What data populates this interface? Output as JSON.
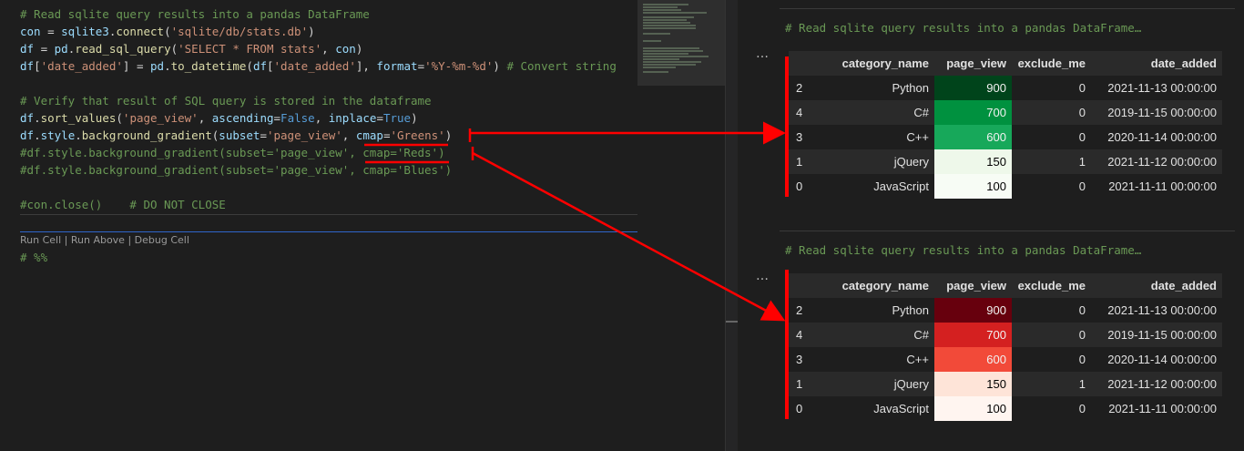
{
  "editor": {
    "lines": [
      [
        {
          "t": "# Read sqlite query results into a pandas DataFrame",
          "c": "cmt"
        }
      ],
      [
        {
          "t": "con",
          "c": "var"
        },
        {
          "t": " = ",
          "c": "pl"
        },
        {
          "t": "sqlite3",
          "c": "var"
        },
        {
          "t": ".",
          "c": "pl"
        },
        {
          "t": "connect",
          "c": "fn"
        },
        {
          "t": "(",
          "c": "pl"
        },
        {
          "t": "'sqlite/db/stats.db'",
          "c": "str"
        },
        {
          "t": ")",
          "c": "pl"
        }
      ],
      [
        {
          "t": "df",
          "c": "var"
        },
        {
          "t": " = ",
          "c": "pl"
        },
        {
          "t": "pd",
          "c": "var"
        },
        {
          "t": ".",
          "c": "pl"
        },
        {
          "t": "read_sql_query",
          "c": "fn"
        },
        {
          "t": "(",
          "c": "pl"
        },
        {
          "t": "'SELECT * FROM stats'",
          "c": "str"
        },
        {
          "t": ", ",
          "c": "pl"
        },
        {
          "t": "con",
          "c": "var"
        },
        {
          "t": ")",
          "c": "pl"
        }
      ],
      [
        {
          "t": "df",
          "c": "var"
        },
        {
          "t": "[",
          "c": "pl"
        },
        {
          "t": "'date_added'",
          "c": "str"
        },
        {
          "t": "] = ",
          "c": "pl"
        },
        {
          "t": "pd",
          "c": "var"
        },
        {
          "t": ".",
          "c": "pl"
        },
        {
          "t": "to_datetime",
          "c": "fn"
        },
        {
          "t": "(",
          "c": "pl"
        },
        {
          "t": "df",
          "c": "var"
        },
        {
          "t": "[",
          "c": "pl"
        },
        {
          "t": "'date_added'",
          "c": "str"
        },
        {
          "t": "], ",
          "c": "pl"
        },
        {
          "t": "format",
          "c": "var"
        },
        {
          "t": "=",
          "c": "pl"
        },
        {
          "t": "'%Y-%m-%d'",
          "c": "str"
        },
        {
          "t": ") ",
          "c": "pl"
        },
        {
          "t": "# Convert string",
          "c": "cmt"
        }
      ],
      [],
      [
        {
          "t": "# Verify that result of SQL query is stored in the dataframe",
          "c": "cmt"
        }
      ],
      [
        {
          "t": "df",
          "c": "var"
        },
        {
          "t": ".",
          "c": "pl"
        },
        {
          "t": "sort_values",
          "c": "fn"
        },
        {
          "t": "(",
          "c": "pl"
        },
        {
          "t": "'page_view'",
          "c": "str"
        },
        {
          "t": ", ",
          "c": "pl"
        },
        {
          "t": "ascending",
          "c": "var"
        },
        {
          "t": "=",
          "c": "pl"
        },
        {
          "t": "False",
          "c": "kw"
        },
        {
          "t": ", ",
          "c": "pl"
        },
        {
          "t": "inplace",
          "c": "var"
        },
        {
          "t": "=",
          "c": "pl"
        },
        {
          "t": "True",
          "c": "kw"
        },
        {
          "t": ")",
          "c": "pl"
        }
      ],
      [
        {
          "t": "df",
          "c": "var"
        },
        {
          "t": ".",
          "c": "pl"
        },
        {
          "t": "style",
          "c": "var"
        },
        {
          "t": ".",
          "c": "pl"
        },
        {
          "t": "background_gradient",
          "c": "fn"
        },
        {
          "t": "(",
          "c": "pl"
        },
        {
          "t": "subset",
          "c": "var"
        },
        {
          "t": "=",
          "c": "pl"
        },
        {
          "t": "'page_view'",
          "c": "str"
        },
        {
          "t": ", ",
          "c": "pl"
        },
        {
          "t": "cmap",
          "c": "var"
        },
        {
          "t": "=",
          "c": "pl"
        },
        {
          "t": "'Greens'",
          "c": "str"
        },
        {
          "t": ")",
          "c": "pl"
        }
      ],
      [
        {
          "t": "#df.style.background_gradient(subset='page_view', cmap='Reds')",
          "c": "cmt"
        }
      ],
      [
        {
          "t": "#df.style.background_gradient(subset='page_view', cmap='Blues')",
          "c": "cmt"
        }
      ],
      [],
      [
        {
          "t": "#con.close()    # DO NOT CLOSE",
          "c": "cmt"
        }
      ]
    ],
    "codelens": "Run Cell | Run Above | Debug Cell",
    "next_cell": "# %%"
  },
  "outputs": [
    {
      "header": "# Read sqlite query results into a pandas DataFrame…",
      "ellipsis": "…",
      "columns": [
        "",
        "category_name",
        "page_view",
        "exclude_me",
        "date_added"
      ],
      "rows": [
        {
          "idx": "2",
          "category": "Python",
          "page_view": "900",
          "exclude": "0",
          "date": "2021-11-13 00:00:00",
          "bg": "#00441b",
          "fg": "#f1f1f1"
        },
        {
          "idx": "4",
          "category": "C#",
          "page_view": "700",
          "exclude": "0",
          "date": "2019-11-15 00:00:00",
          "bg": "#00913f",
          "fg": "#f1f1f1"
        },
        {
          "idx": "3",
          "category": "C++",
          "page_view": "600",
          "exclude": "0",
          "date": "2020-11-14 00:00:00",
          "bg": "#17a85a",
          "fg": "#f1f1f1"
        },
        {
          "idx": "1",
          "category": "jQuery",
          "page_view": "150",
          "exclude": "1",
          "date": "2021-11-12 00:00:00",
          "bg": "#eef8ea",
          "fg": "#000000"
        },
        {
          "idx": "0",
          "category": "JavaScript",
          "page_view": "100",
          "exclude": "0",
          "date": "2021-11-11 00:00:00",
          "bg": "#f7fcf5",
          "fg": "#000000"
        }
      ]
    },
    {
      "header": "# Read sqlite query results into a pandas DataFrame…",
      "ellipsis": "…",
      "columns": [
        "",
        "category_name",
        "page_view",
        "exclude_me",
        "date_added"
      ],
      "rows": [
        {
          "idx": "2",
          "category": "Python",
          "page_view": "900",
          "exclude": "0",
          "date": "2021-11-13 00:00:00",
          "bg": "#67000d",
          "fg": "#f1f1f1"
        },
        {
          "idx": "4",
          "category": "C#",
          "page_view": "700",
          "exclude": "0",
          "date": "2019-11-15 00:00:00",
          "bg": "#d42020",
          "fg": "#f1f1f1"
        },
        {
          "idx": "3",
          "category": "C++",
          "page_view": "600",
          "exclude": "0",
          "date": "2020-11-14 00:00:00",
          "bg": "#f24a39",
          "fg": "#f1f1f1"
        },
        {
          "idx": "1",
          "category": "jQuery",
          "page_view": "150",
          "exclude": "1",
          "date": "2021-11-12 00:00:00",
          "bg": "#fee4d8",
          "fg": "#000000"
        },
        {
          "idx": "0",
          "category": "JavaScript",
          "page_view": "100",
          "exclude": "0",
          "date": "2021-11-11 00:00:00",
          "bg": "#fff5f0",
          "fg": "#000000"
        }
      ]
    }
  ],
  "colors": {
    "annotation_red": "#ff0000",
    "cell_focus_border": "#2f65ca"
  }
}
